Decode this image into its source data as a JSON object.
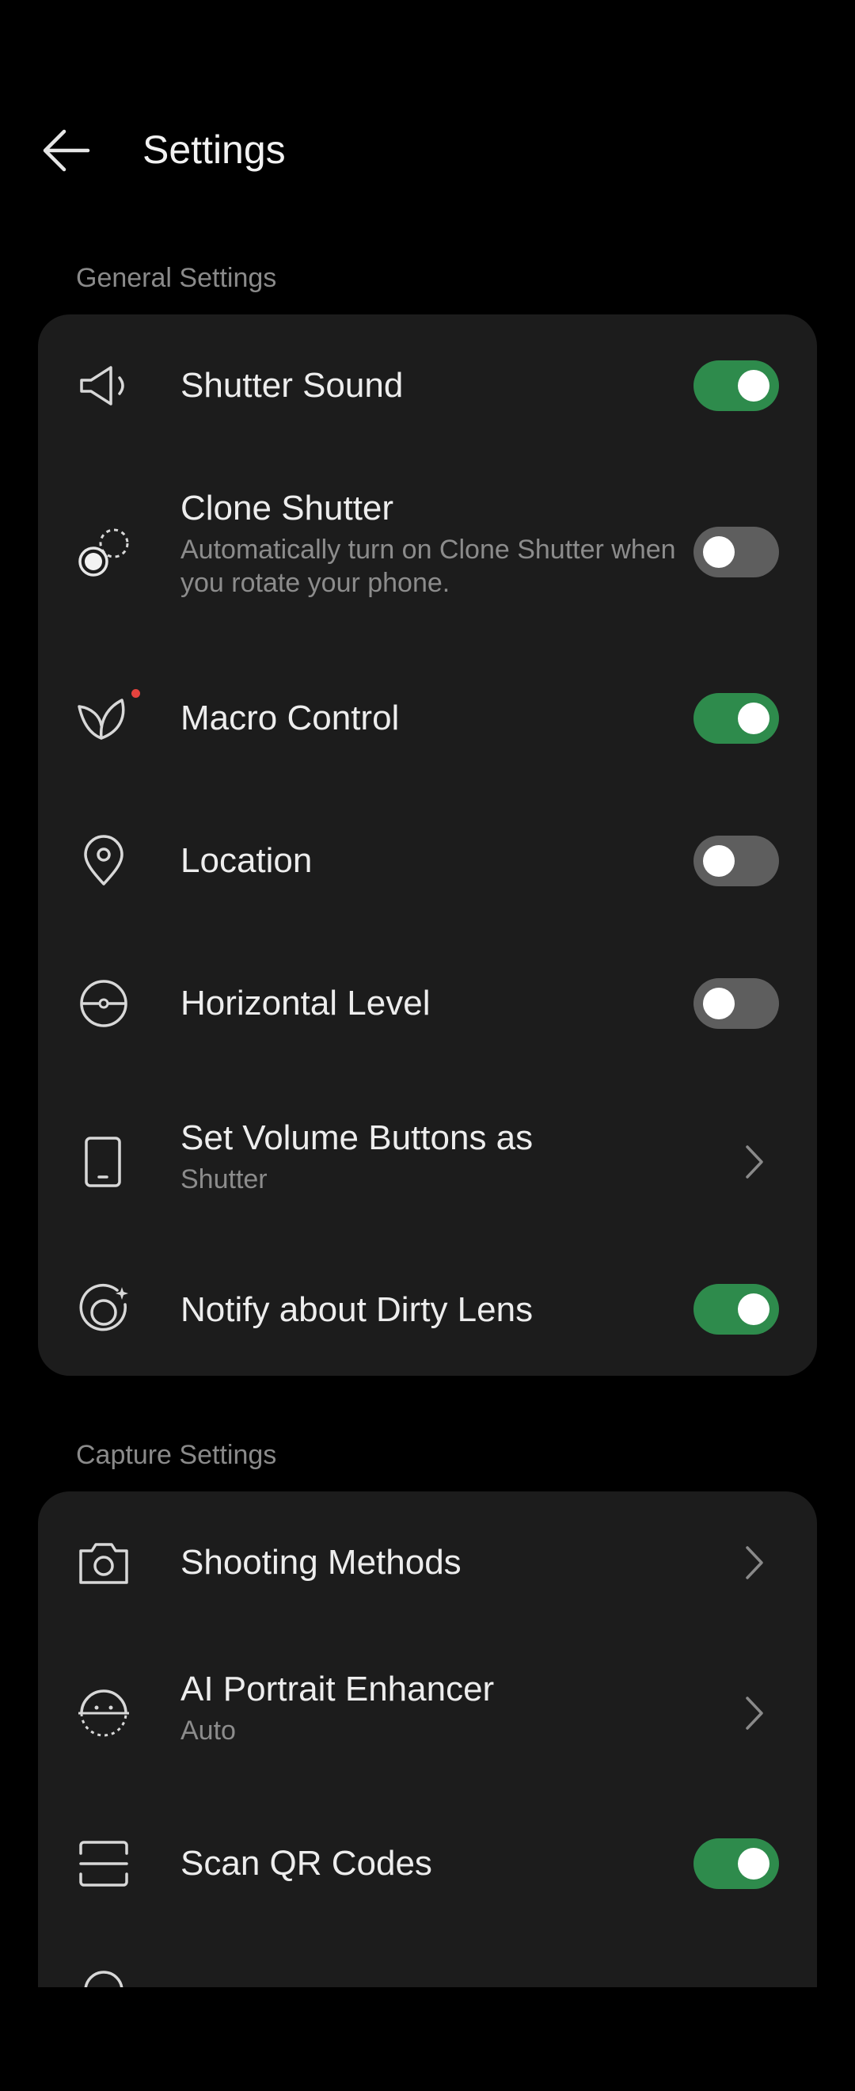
{
  "header": {
    "title": "Settings"
  },
  "sections": {
    "general": {
      "label": "General Settings",
      "items": {
        "shutter_sound": {
          "label": "Shutter Sound",
          "on": true,
          "icon": "speaker-icon"
        },
        "clone_shutter": {
          "label": "Clone Shutter",
          "subtitle": "Automatically turn on Clone Shutter when you rotate your phone.",
          "on": false,
          "icon": "clone-shutter-icon"
        },
        "macro_control": {
          "label": "Macro Control",
          "on": true,
          "icon": "leaf-icon"
        },
        "location": {
          "label": "Location",
          "on": false,
          "icon": "location-pin-icon"
        },
        "horizontal_level": {
          "label": "Horizontal Level",
          "on": false,
          "icon": "level-icon"
        },
        "volume_buttons": {
          "label": "Set Volume Buttons as",
          "value": "Shutter",
          "icon": "phone-icon"
        },
        "dirty_lens": {
          "label": "Notify about Dirty Lens",
          "on": true,
          "icon": "lens-icon"
        }
      }
    },
    "capture": {
      "label": "Capture Settings",
      "items": {
        "shooting_methods": {
          "label": "Shooting Methods",
          "icon": "camera-icon"
        },
        "ai_portrait": {
          "label": "AI Portrait Enhancer",
          "value": "Auto",
          "icon": "face-icon"
        },
        "scan_qr": {
          "label": "Scan QR Codes",
          "on": true,
          "icon": "scan-icon"
        }
      }
    }
  },
  "colors": {
    "toggle_on": "#2e8b4c",
    "toggle_off": "#5e5e5e",
    "card": "#1c1c1c",
    "background": "#000000",
    "notification_dot": "#e5433e"
  }
}
